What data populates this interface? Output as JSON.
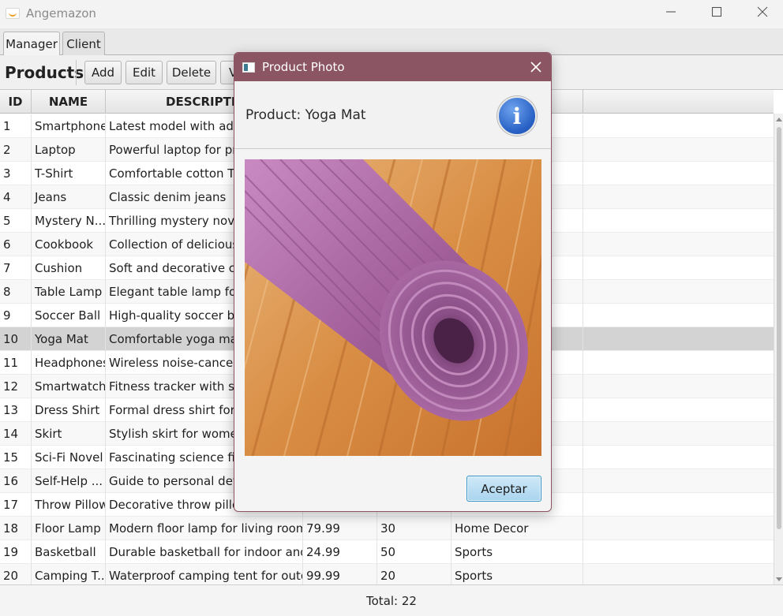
{
  "window": {
    "title": "Angemazon",
    "controls": [
      "minimize-icon",
      "maximize-icon",
      "close-icon"
    ]
  },
  "tabs": [
    {
      "label": "Manager",
      "active": true
    },
    {
      "label": "Client",
      "active": false
    }
  ],
  "toolbar": {
    "title": "Products",
    "buttons": [
      {
        "label": "Add"
      },
      {
        "label": "Edit"
      },
      {
        "label": "Delete"
      },
      {
        "label": "V"
      }
    ]
  },
  "table": {
    "columns": [
      "ID",
      "NAME",
      "DESCRIPTIO"
    ],
    "selected_row": 9,
    "rows": [
      {
        "id": "1",
        "name": "Smartphone",
        "desc": "Latest model with advar",
        "price": "",
        "stock": "",
        "category": ""
      },
      {
        "id": "2",
        "name": "Laptop",
        "desc": "Powerful laptop for prof",
        "price": "",
        "stock": "",
        "category": ""
      },
      {
        "id": "3",
        "name": "T-Shirt",
        "desc": "Comfortable cotton T-sh",
        "price": "",
        "stock": "",
        "category": ""
      },
      {
        "id": "4",
        "name": "Jeans",
        "desc": "Classic denim jeans",
        "price": "",
        "stock": "",
        "category": ""
      },
      {
        "id": "5",
        "name": "Mystery N...",
        "desc": "Thrilling mystery novel",
        "price": "",
        "stock": "",
        "category": ""
      },
      {
        "id": "6",
        "name": "Cookbook",
        "desc": "Collection of delicious re",
        "price": "",
        "stock": "",
        "category": ""
      },
      {
        "id": "7",
        "name": "Cushion",
        "desc": "Soft and decorative cush",
        "price": "",
        "stock": "",
        "category": ""
      },
      {
        "id": "8",
        "name": "Table Lamp",
        "desc": "Elegant table lamp for h",
        "price": "",
        "stock": "",
        "category": ""
      },
      {
        "id": "9",
        "name": "Soccer Ball",
        "desc": "High-quality soccer ball",
        "price": "",
        "stock": "",
        "category": ""
      },
      {
        "id": "10",
        "name": "Yoga Mat",
        "desc": "Comfortable yoga mat f",
        "price": "",
        "stock": "",
        "category": ""
      },
      {
        "id": "11",
        "name": "Headphones",
        "desc": "Wireless noise-canceling",
        "price": "",
        "stock": "",
        "category": ""
      },
      {
        "id": "12",
        "name": "Smartwatch",
        "desc": "Fitness tracker with sma",
        "price": "",
        "stock": "",
        "category": ""
      },
      {
        "id": "13",
        "name": "Dress Shirt",
        "desc": "Formal dress shirt for m",
        "price": "",
        "stock": "",
        "category": ""
      },
      {
        "id": "14",
        "name": "Skirt",
        "desc": "Stylish skirt for women",
        "price": "",
        "stock": "",
        "category": ""
      },
      {
        "id": "15",
        "name": "Sci-Fi Novel",
        "desc": "Fascinating science fictio",
        "price": "",
        "stock": "",
        "category": ""
      },
      {
        "id": "16",
        "name": "Self-Help ...",
        "desc": "Guide to personal devel",
        "price": "",
        "stock": "",
        "category": ""
      },
      {
        "id": "17",
        "name": "Throw Pillow",
        "desc": "Decorative throw pillow",
        "price": "",
        "stock": "",
        "category": ""
      },
      {
        "id": "18",
        "name": "Floor Lamp",
        "desc": "Modern floor lamp for living rooms",
        "price": "79.99",
        "stock": "30",
        "category": "Home Decor"
      },
      {
        "id": "19",
        "name": "Basketball",
        "desc": "Durable basketball for indoor and ...",
        "price": "24.99",
        "stock": "50",
        "category": "Sports"
      },
      {
        "id": "20",
        "name": "Camping T...",
        "desc": "Waterproof camping tent for outd...",
        "price": "99.99",
        "stock": "20",
        "category": "Sports"
      }
    ]
  },
  "footer": {
    "total": "Total: 22"
  },
  "dialog": {
    "title": "Product Photo",
    "header": "Product: Yoga Mat",
    "icon": "info-icon",
    "ok_label": "Aceptar",
    "colors": {
      "titlebar": "#8b5564",
      "ok_button": "#a9d4ee"
    }
  }
}
